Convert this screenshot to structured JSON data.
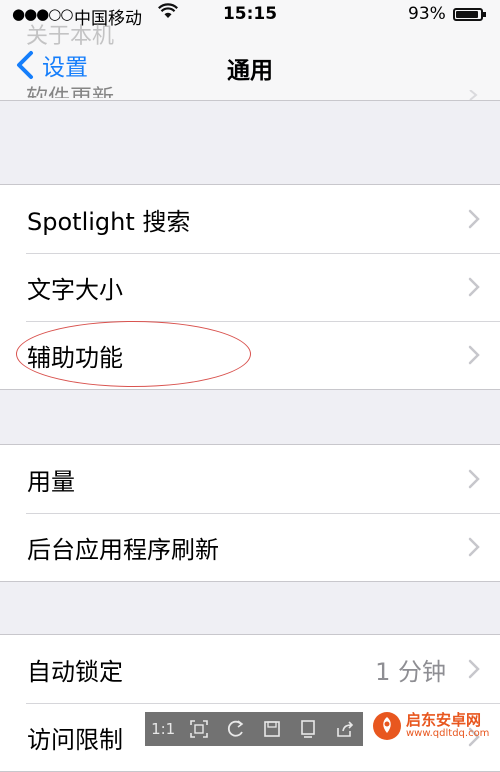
{
  "status_bar": {
    "signal": "●●●○○",
    "carrier": "中国移动",
    "time": "15:15",
    "battery_percent": "93%",
    "battery_level": 0.93
  },
  "nav": {
    "back_label": "设置",
    "title": "通用",
    "ghost_top": "关于本机",
    "ghost_bottom": "软件更新"
  },
  "groups": [
    {
      "rows": [
        {
          "label": "Spotlight 搜索"
        },
        {
          "label": "文字大小"
        },
        {
          "label": "辅助功能"
        }
      ]
    },
    {
      "rows": [
        {
          "label": "用量"
        },
        {
          "label": "后台应用程序刷新"
        }
      ]
    },
    {
      "rows": [
        {
          "label": "自动锁定",
          "value": "1 分钟"
        },
        {
          "label": "访问限制"
        }
      ]
    }
  ],
  "toolbar": {
    "ratio_label": "1:1"
  },
  "watermark": {
    "name": "启东安卓网",
    "url": "www.qdltdq.com"
  },
  "colors": {
    "accent": "#157efb",
    "annotation": "#d9534f",
    "watermark": "#e8571f"
  }
}
